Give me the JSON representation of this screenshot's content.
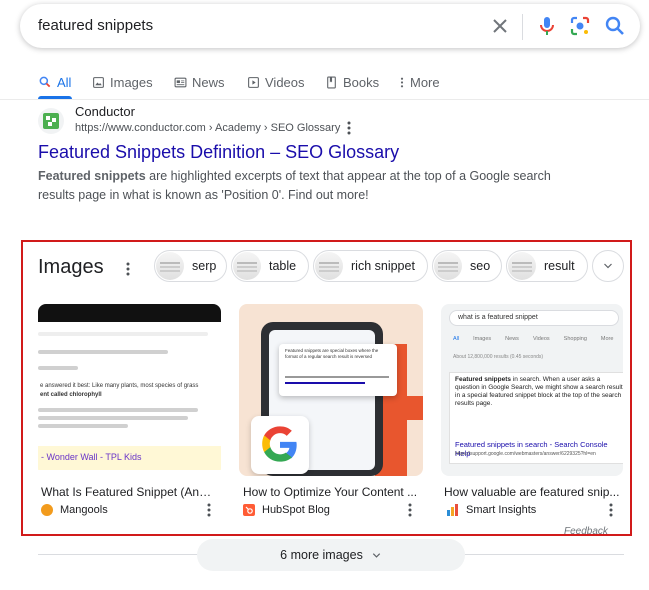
{
  "search": {
    "query": "featured snippets"
  },
  "tabs": [
    {
      "label": "All",
      "icon": "search-icon",
      "active": true
    },
    {
      "label": "Images",
      "icon": "image-icon"
    },
    {
      "label": "News",
      "icon": "news-icon"
    },
    {
      "label": "Videos",
      "icon": "video-icon"
    },
    {
      "label": "Books",
      "icon": "book-icon"
    },
    {
      "label": "More",
      "icon": "more-vert-icon"
    }
  ],
  "result": {
    "site_name": "Conductor",
    "url": "https://www.conductor.com › Academy › SEO Glossary",
    "title": "Featured Snippets Definition – SEO Glossary",
    "snippet_bold": "Featured snippets",
    "snippet_rest": " are highlighted excerpts of text that appear at the top of a Google search results page in what is known as 'Position 0'. Find out more!"
  },
  "images": {
    "heading": "Images",
    "chips": [
      "serp",
      "table",
      "rich snippet",
      "seo",
      "result"
    ],
    "cards": [
      {
        "caption": "What Is Featured Snippet (And ...",
        "source": "Mangools",
        "source_color": "#f29b1d"
      },
      {
        "caption": "How to Optimize Your Content ...",
        "source": "HubSpot Blog",
        "source_color": "#ff5c35"
      },
      {
        "caption": "How valuable are featured snip...",
        "source": "Smart Insights",
        "source_color": "#2b8dd6"
      }
    ],
    "thumb1": {
      "line1": "e answered it best: Like many plants, most species of grass",
      "line2": "ent called chlorophyll",
      "link": "- Wonder Wall - TPL Kids"
    },
    "thumb2": {
      "popup": "Featured snippets are special boxes where the format of a regular search result is reversed"
    },
    "thumb3": {
      "query": "what is a featured snippet",
      "nav": [
        "All",
        "Images",
        "News",
        "Videos",
        "Shopping",
        "More"
      ],
      "stats": "About 12,800,000 results (0.45 seconds)",
      "body_bold": "Featured snippets",
      "body": "in search. When a user asks a question in Google Search, we might show a search result in a special featured snippet block at the top of the search results page.",
      "link": "Featured snippets in search - Search Console Help",
      "link_url": "https://support.google.com/webmasters/answer/6229325?hl=en"
    },
    "feedback": "Feedback",
    "more_label": "6 more images"
  },
  "colors": {
    "link": "#1a0dab",
    "accent": "#1a73e8",
    "highlight_border": "#d11a1a"
  }
}
